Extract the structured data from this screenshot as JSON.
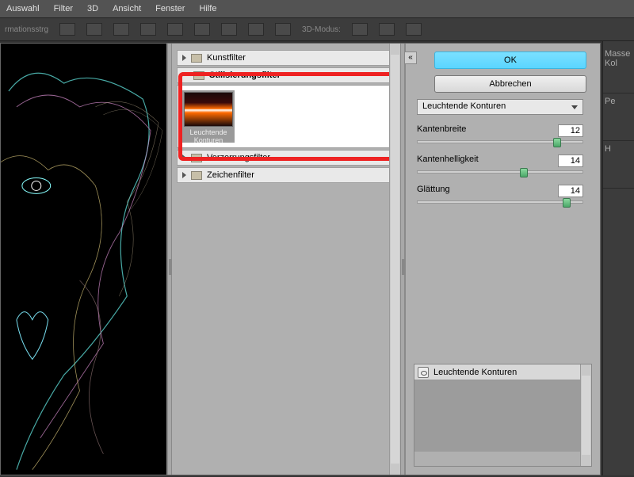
{
  "menu": {
    "items": [
      "Auswahl",
      "Filter",
      "3D",
      "Ansicht",
      "Fenster",
      "Hilfe"
    ]
  },
  "toolbar": {
    "label_left": "rmationsstrg",
    "label_3d": "3D-Modus:"
  },
  "rightdock": {
    "tab0": "Masse Kol",
    "tab1": "Pe",
    "tab2": "H"
  },
  "tree": {
    "items": [
      {
        "label": "Kunstfilter",
        "open": false
      },
      {
        "label": "Stilisierungsfilter",
        "open": true,
        "bold": true,
        "thumbs": [
          {
            "label": "Leuchtende Konturen"
          }
        ]
      },
      {
        "label": "Verzerrungsfilter",
        "open": false
      },
      {
        "label": "Zeichenfilter",
        "open": false
      }
    ],
    "hidden_label": ""
  },
  "buttons": {
    "ok": "OK",
    "cancel": "Abbrechen"
  },
  "dropdown": {
    "selected": "Leuchtende Konturen"
  },
  "sliders": [
    {
      "label": "Kantenbreite",
      "value": "12",
      "pos": 82
    },
    {
      "label": "Kantenhelligkeit",
      "value": "14",
      "pos": 62
    },
    {
      "label": "Glättung",
      "value": "14",
      "pos": 88
    }
  ],
  "layers": {
    "title": "Leuchtende Konturen"
  }
}
